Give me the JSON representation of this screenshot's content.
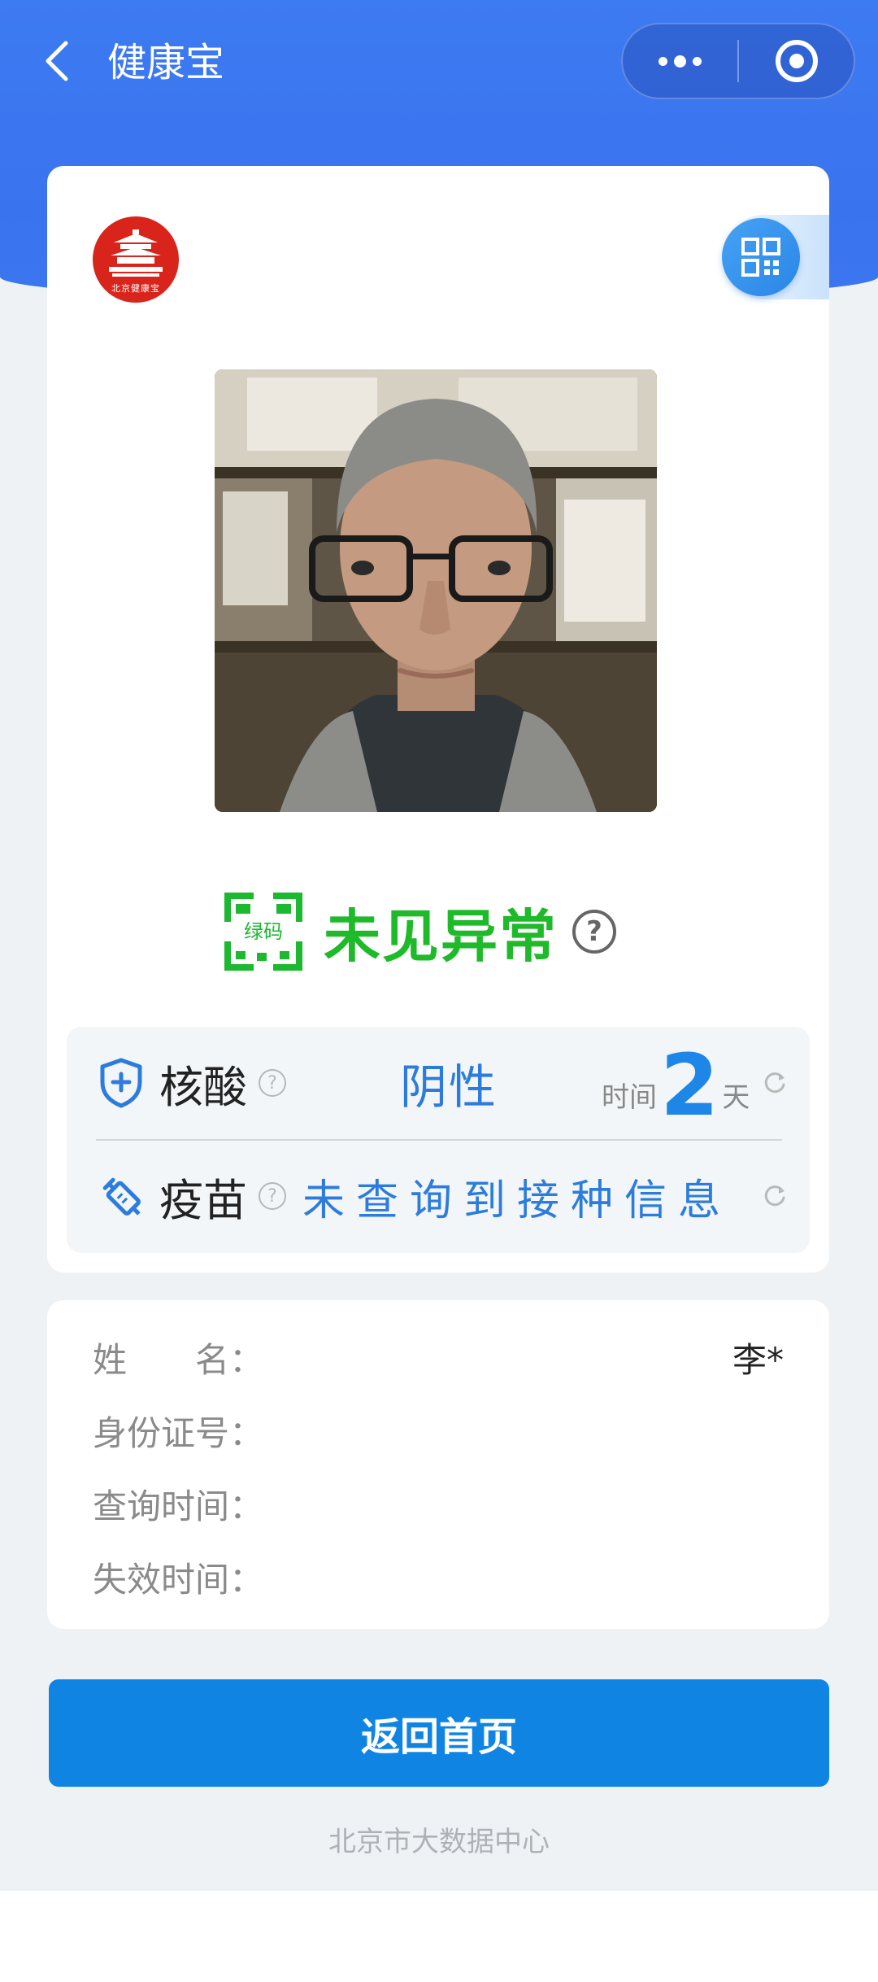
{
  "header": {
    "title": "健康宝"
  },
  "logo": {
    "caption": "北京健康宝"
  },
  "status": {
    "code_label": "绿码",
    "text": "未见异常",
    "help": "?",
    "color": "#1fba2a"
  },
  "nucleic": {
    "label": "核酸",
    "help": "?",
    "result": "阴性",
    "time_prefix": "时间",
    "days": "2",
    "time_suffix": "天"
  },
  "vaccine": {
    "label": "疫苗",
    "help": "?",
    "result": "未查询到接种信息"
  },
  "person": {
    "name_label": "姓　　名：",
    "name_value": "李*",
    "id_label": "身份证号：",
    "query_time_label": "查询时间：",
    "expire_time_label": "失效时间："
  },
  "actions": {
    "home_button": "返回首页"
  },
  "footer": {
    "text": "北京市大数据中心"
  },
  "colors": {
    "brand_blue": "#3d7bf2",
    "button_blue": "#0f84e3",
    "result_blue": "#2d7cdc",
    "logo_red": "#d9241c"
  }
}
